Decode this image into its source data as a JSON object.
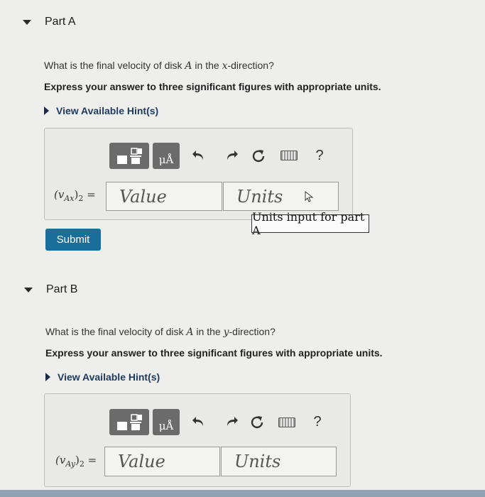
{
  "partA": {
    "title": "Part A",
    "question": "What is the final velocity of disk A in the x-direction?",
    "question_parts": [
      "What is the final velocity of disk ",
      "A",
      " in the ",
      "x",
      "-direction?"
    ],
    "instruction": "Express your answer to three significant figures with appropriate units.",
    "hint": "View Available Hint(s)",
    "toolbar": {
      "units_button": "μÅ",
      "help": "?"
    },
    "variable_label": "(vAx)2 =",
    "variable": {
      "base": "(v",
      "sub": "Ax",
      "close": ")",
      "sub2": "2",
      "eq": " ="
    },
    "value_placeholder": "Value",
    "units_placeholder": "Units",
    "units_tooltip": "Units input for part A",
    "submit_label": "Submit"
  },
  "partB": {
    "title": "Part B",
    "question": "What is the final velocity of disk A in the y-direction?",
    "question_parts": [
      "What is the final velocity of disk ",
      "A",
      " in the ",
      "y",
      "-direction?"
    ],
    "instruction": "Express your answer to three significant figures with appropriate units.",
    "hint": "View Available Hint(s)",
    "toolbar": {
      "units_button": "μÅ",
      "help": "?"
    },
    "variable_label": "(vAy)2 =",
    "variable": {
      "base": "(v",
      "sub": "Ay",
      "close": ")",
      "sub2": "2",
      "eq": " ="
    },
    "value_placeholder": "Value",
    "units_placeholder": "Units"
  },
  "icons": {
    "collapse": "caret-down-icon",
    "hint": "caret-right-icon",
    "templates": "fraction-template-icon",
    "undo": "undo-icon",
    "redo": "redo-icon",
    "reset": "reset-icon",
    "keyboard": "keyboard-icon",
    "cursor": "mouse-pointer-icon"
  },
  "colors": {
    "submit": "#1a6e9a",
    "hint": "#1f3a5c",
    "toolbar_button": "#6b6b6b"
  }
}
